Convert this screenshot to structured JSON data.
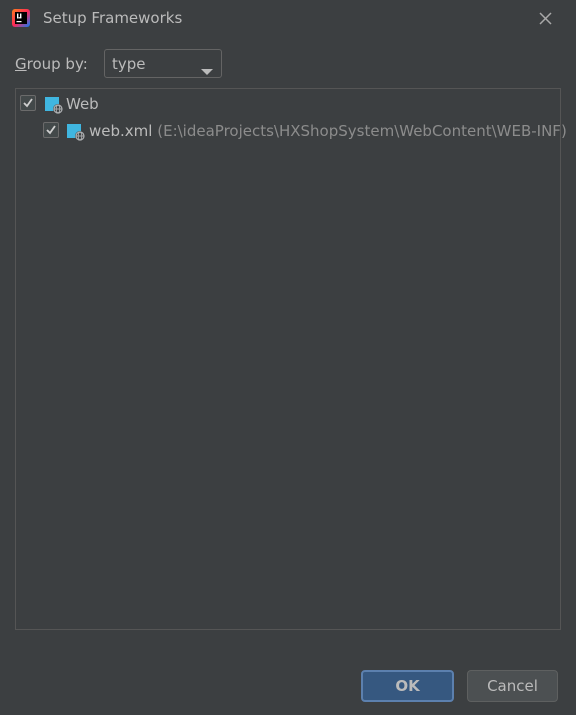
{
  "window": {
    "title": "Setup Frameworks"
  },
  "group_by": {
    "label_mnemonic": "G",
    "label_rest": "roup by:",
    "selected": "type"
  },
  "tree": {
    "root": {
      "label": "Web",
      "checked": true
    },
    "child": {
      "label": "web.xml",
      "path": "(E:\\ideaProjects\\HXShopSystem\\WebContent\\WEB-INF)",
      "checked": true
    }
  },
  "buttons": {
    "ok": "OK",
    "cancel": "Cancel"
  },
  "colors": {
    "background": "#3c3f41",
    "text": "#bbbbbb",
    "path_text": "#8c8c8c",
    "ok_button": "#365880",
    "ok_border": "#5c80ae",
    "cancel_button": "#4c5052"
  },
  "icons": {
    "app": "intellij-idea-icon",
    "close": "close-icon",
    "dropdown": "chevron-down-icon",
    "web_module": "web-framework-icon",
    "web_xml": "web-xml-file-icon"
  }
}
